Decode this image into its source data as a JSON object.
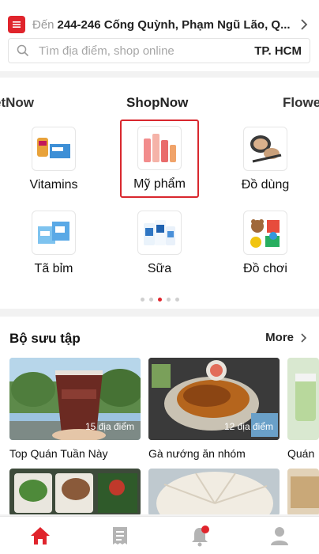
{
  "header": {
    "address_prefix": "Đến",
    "address": "244-246 Cống Quỳnh, Phạm Ngũ Lão, Q...",
    "search_placeholder": "Tìm địa điểm, shop online",
    "city": "TP. HCM"
  },
  "services": {
    "tabs": [
      "etNow",
      "ShopNow",
      "Flowe"
    ],
    "categories": [
      {
        "label": "Vitamins",
        "icon": "vitamins-icon"
      },
      {
        "label": "Mỹ phẩm",
        "icon": "cosmetics-icon",
        "selected": true
      },
      {
        "label": "Đồ dùng",
        "icon": "makeup-supplies-icon"
      },
      {
        "label": "Tã bỉm",
        "icon": "diapers-icon"
      },
      {
        "label": "Sữa",
        "icon": "milk-icon"
      },
      {
        "label": "Đồ chơi",
        "icon": "toys-icon"
      }
    ],
    "page_indicator": {
      "count": 5,
      "active": 3
    }
  },
  "collections": {
    "title": "Bộ sưu tập",
    "more_label": "More",
    "cards": [
      {
        "label": "Top Quán Tuần Này",
        "count": "15 địa điểm"
      },
      {
        "label": "Gà nướng ăn nhóm",
        "count": "12 địa điểm"
      },
      {
        "label": "Quán"
      }
    ]
  },
  "bottom_nav": [
    {
      "icon": "home-icon",
      "active": true
    },
    {
      "icon": "orders-icon"
    },
    {
      "icon": "notifications-icon",
      "badge": true
    },
    {
      "icon": "profile-icon"
    }
  ],
  "colors": {
    "accent": "#e0242c",
    "text": "#222222",
    "muted": "#a7a7a7"
  }
}
